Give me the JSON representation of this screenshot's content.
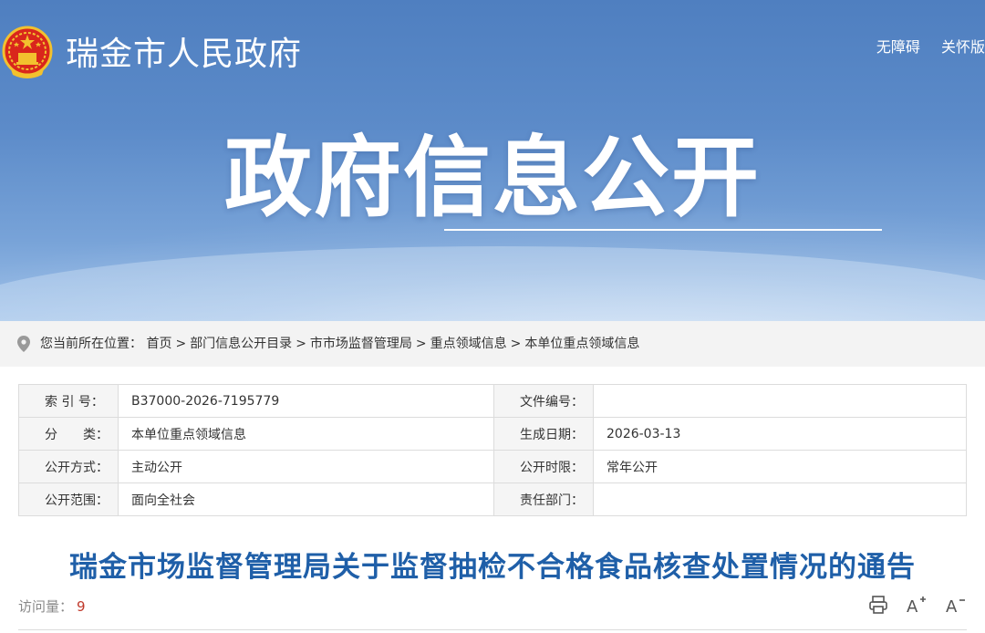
{
  "header": {
    "site_name": "瑞金市人民政府",
    "links": [
      "无障碍",
      "关怀版"
    ],
    "banner_title": "政府信息公开"
  },
  "breadcrumb": {
    "prefix": "您当前所在位置：",
    "items": [
      "首页",
      "部门信息公开目录",
      "市市场监督管理局",
      "重点领域信息",
      "本单位重点领域信息"
    ],
    "separator": ">"
  },
  "meta": {
    "index_label": "索 引 号：",
    "index_value": "B37000-2026-7195779",
    "docno_label": "文件编号：",
    "docno_value": "",
    "category_label": "分　　类：",
    "category_value": "本单位重点领域信息",
    "date_label": "生成日期：",
    "date_value": "2026-03-13",
    "method_label": "公开方式：",
    "method_value": "主动公开",
    "period_label": "公开时限：",
    "period_value": "常年公开",
    "scope_label": "公开范围：",
    "scope_value": "面向全社会",
    "dept_label": "责任部门：",
    "dept_value": ""
  },
  "article": {
    "title": "瑞金市场监督管理局关于监督抽检不合格食品核查处置情况的通告",
    "visits_label": "访问量：",
    "visits_count": "9"
  },
  "tools": {
    "icons": [
      "print-icon",
      "font-increase-icon",
      "font-decrease-icon"
    ],
    "increase_glyph": "A",
    "decrease_glyph": "A"
  },
  "colors": {
    "title": "#1f5fa8",
    "banner_top": "#4f7fc0",
    "visits_count": "#c0392b"
  }
}
